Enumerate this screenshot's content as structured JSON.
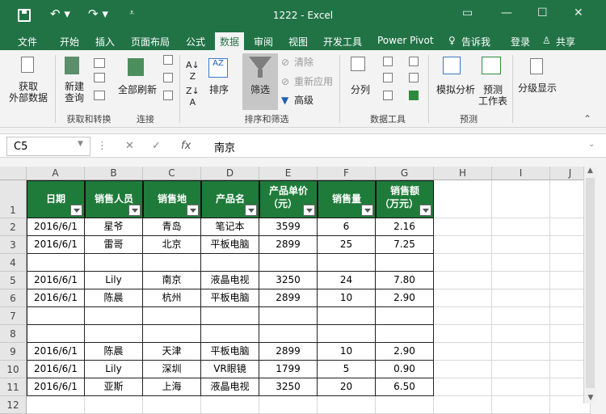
{
  "window": {
    "title": "1222 - Excel"
  },
  "menu": {
    "items": [
      "文件",
      "开始",
      "插入",
      "页面布局",
      "公式",
      "数据",
      "审阅",
      "视图",
      "开发工具",
      "Power Pivot",
      "告诉我",
      "登录",
      "共享"
    ],
    "active": "数据"
  },
  "ribbon": {
    "get_data": "获取\n外部数据",
    "new_query": "新建\n查询",
    "refresh_all": "全部刷新",
    "sort": "排序",
    "filter": "筛选",
    "clear": "清除",
    "reapply": "重新应用",
    "advanced": "高级",
    "split": "分列",
    "whatif": "模拟分析",
    "forecast_sheet": "预测\n工作表",
    "outline": "分级显示",
    "groups": [
      "获取和转换",
      "连接",
      "排序和筛选",
      "数据工具",
      "预测"
    ]
  },
  "formula_bar": {
    "name_box": "C5",
    "content": "南京",
    "fx": "fx"
  },
  "grid": {
    "columns": [
      "A",
      "B",
      "C",
      "D",
      "E",
      "F",
      "G",
      "H",
      "I",
      "J"
    ],
    "rows": [
      "1",
      "2",
      "3",
      "4",
      "5",
      "6",
      "7",
      "8",
      "9",
      "10",
      "11",
      "12"
    ],
    "headers": [
      [
        "日期"
      ],
      [
        "销售人员"
      ],
      [
        "销售地"
      ],
      [
        "产品名"
      ],
      [
        "产品单价",
        "（元）"
      ],
      [
        "销售量"
      ],
      [
        "销售额",
        "（万元）"
      ]
    ],
    "data": [
      [
        "2016/6/1",
        "星爷",
        "青岛",
        "笔记本",
        "3599",
        "6",
        "2.16"
      ],
      [
        "2016/6/1",
        "雷哥",
        "北京",
        "平板电脑",
        "2899",
        "25",
        "7.25"
      ],
      [
        "",
        "",
        "",
        "",
        "",
        "",
        ""
      ],
      [
        "2016/6/1",
        "Lily",
        "南京",
        "液晶电视",
        "3250",
        "24",
        "7.80"
      ],
      [
        "2016/6/1",
        "陈晨",
        "杭州",
        "平板电脑",
        "2899",
        "10",
        "2.90"
      ],
      [
        "",
        "",
        "",
        "",
        "",
        "",
        ""
      ],
      [
        "",
        "",
        "",
        "",
        "",
        "",
        ""
      ],
      [
        "2016/6/1",
        "陈晨",
        "天津",
        "平板电脑",
        "2899",
        "10",
        "2.90"
      ],
      [
        "2016/6/1",
        "Lily",
        "深圳",
        "VR眼镜",
        "1799",
        "5",
        "0.90"
      ],
      [
        "2016/6/1",
        "亚斯",
        "上海",
        "液晶电视",
        "3250",
        "20",
        "6.50"
      ]
    ]
  },
  "colors": {
    "excel_green": "#217346",
    "header_fill": "#1f7b3a"
  }
}
